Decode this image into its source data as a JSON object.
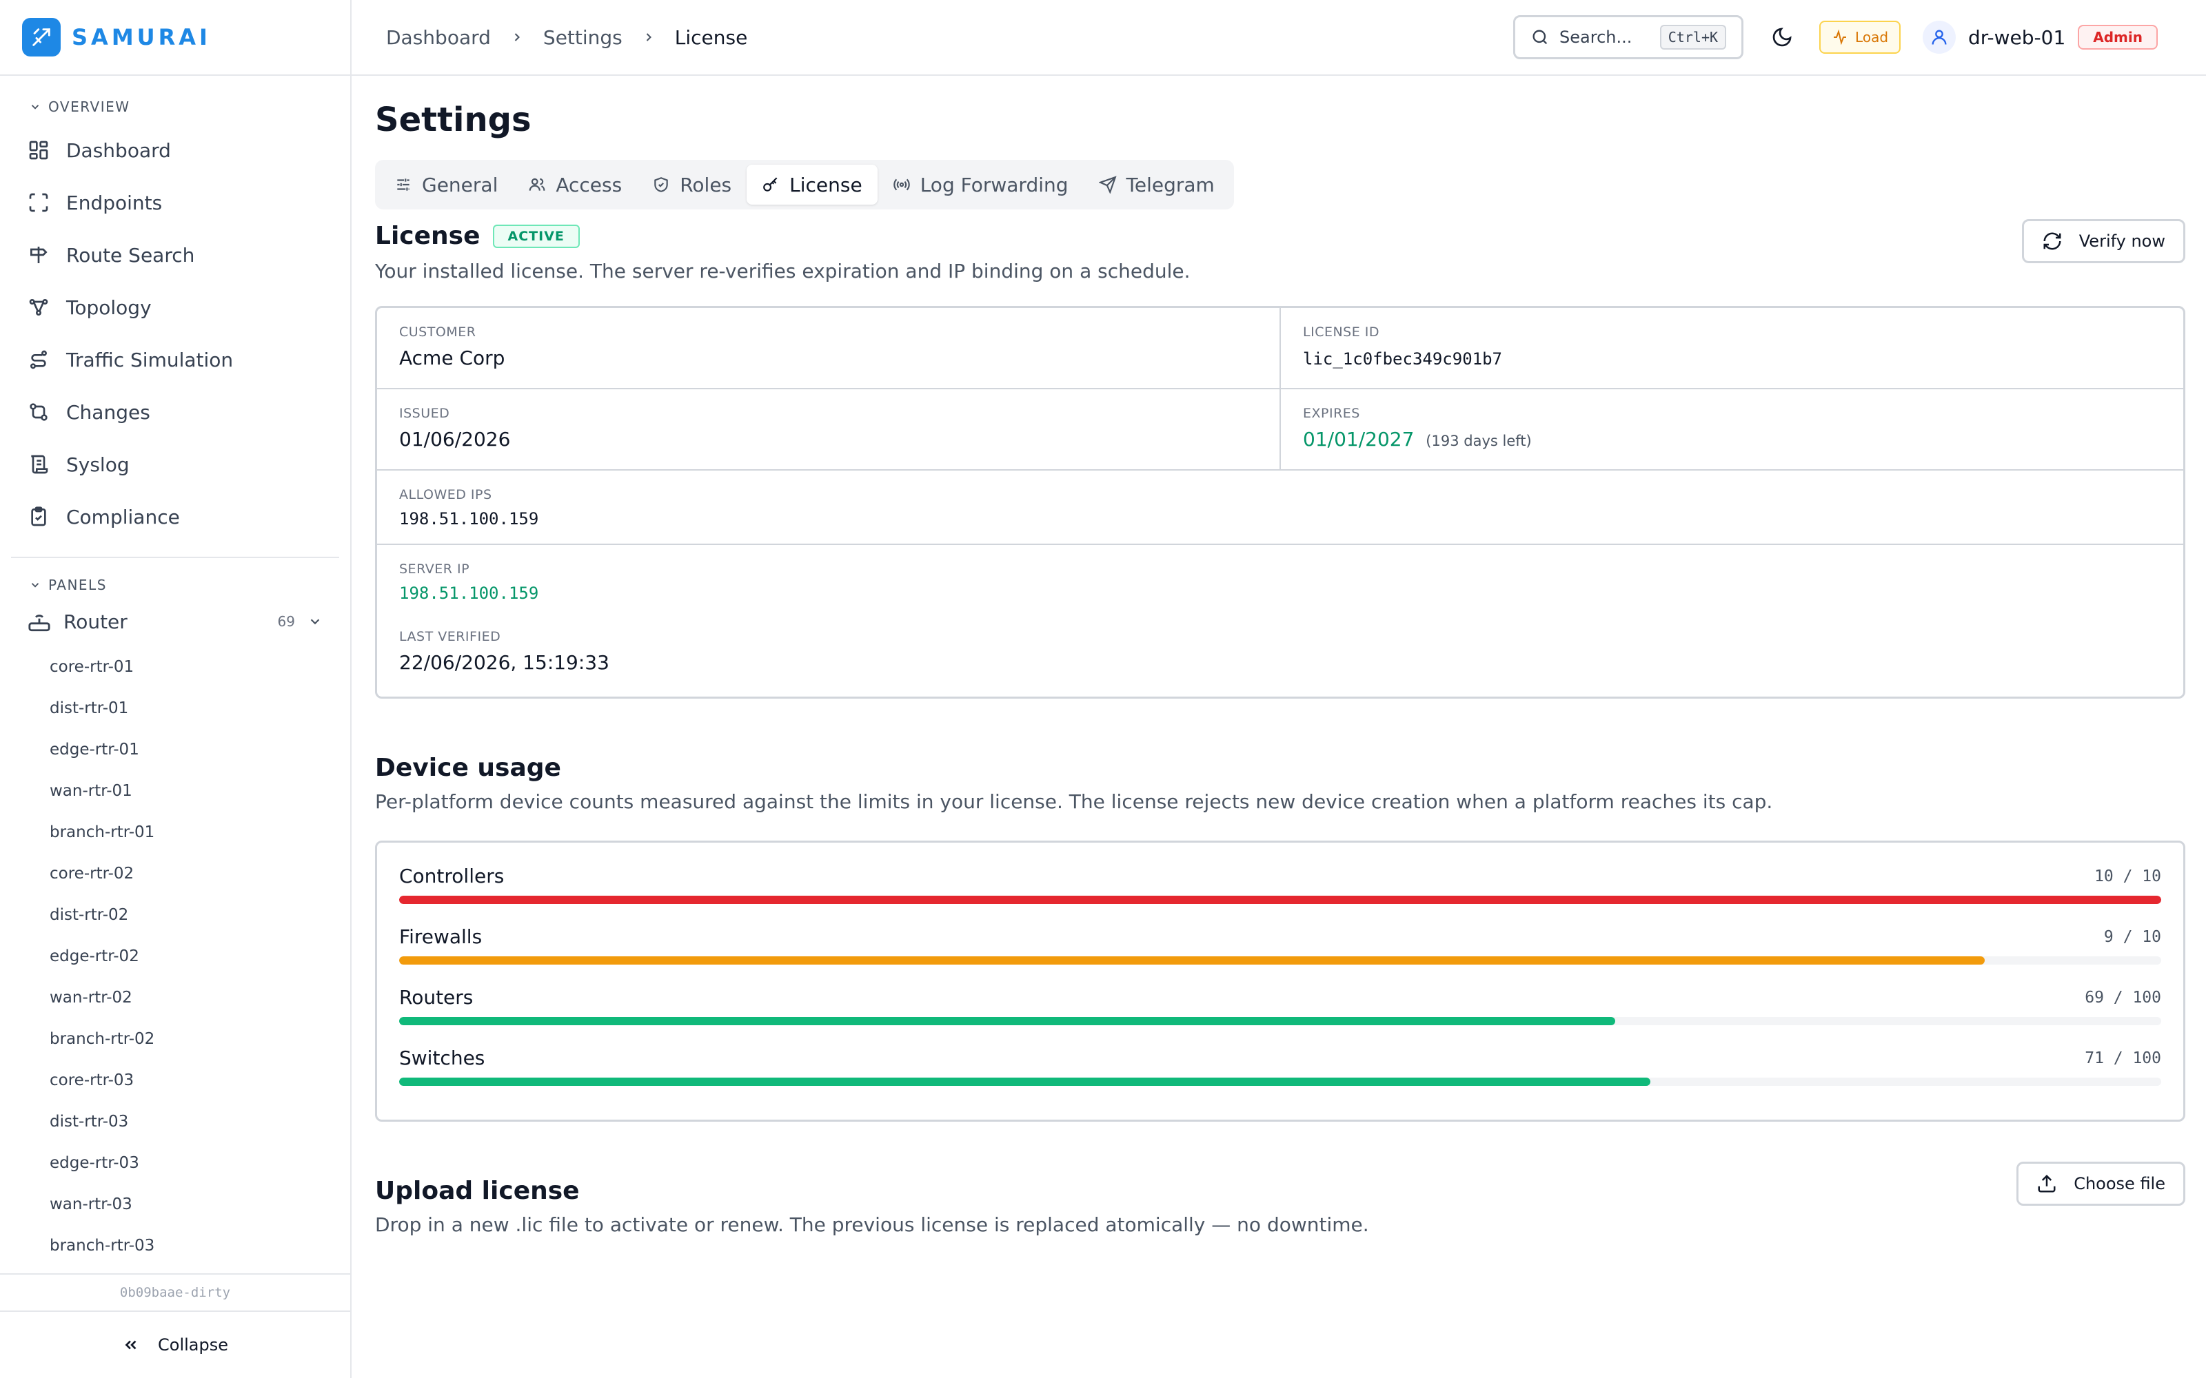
{
  "brand": {
    "name": "SAMURAI",
    "color": "#1e88e5"
  },
  "sidebar": {
    "overview_title": "OVERVIEW",
    "items": [
      {
        "label": "Dashboard",
        "icon": "grid-icon"
      },
      {
        "label": "Endpoints",
        "icon": "scan-frame-icon"
      },
      {
        "label": "Route Search",
        "icon": "signpost-icon"
      },
      {
        "label": "Topology",
        "icon": "topology-icon"
      },
      {
        "label": "Traffic Simulation",
        "icon": "route-icon"
      },
      {
        "label": "Changes",
        "icon": "git-compare-icon"
      },
      {
        "label": "Syslog",
        "icon": "scroll-icon"
      },
      {
        "label": "Compliance",
        "icon": "clipboard-check-icon"
      }
    ],
    "panels_title": "PANELS",
    "router_panel": {
      "label": "Router",
      "count": "69"
    },
    "routers": [
      "core-rtr-01",
      "dist-rtr-01",
      "edge-rtr-01",
      "wan-rtr-01",
      "branch-rtr-01",
      "core-rtr-02",
      "dist-rtr-02",
      "edge-rtr-02",
      "wan-rtr-02",
      "branch-rtr-02",
      "core-rtr-03",
      "dist-rtr-03",
      "edge-rtr-03",
      "wan-rtr-03",
      "branch-rtr-03"
    ],
    "build": "0b09baae-dirty",
    "collapse_label": "Collapse"
  },
  "header": {
    "breadcrumbs": [
      "Dashboard",
      "Settings",
      "License"
    ],
    "search_placeholder": "Search...",
    "search_shortcut": "Ctrl+K",
    "load_label": "Load",
    "user_name": "dr-web-01",
    "user_role": "Admin"
  },
  "page": {
    "title": "Settings",
    "tabs": [
      {
        "label": "General",
        "icon": "sliders-icon",
        "active": false
      },
      {
        "label": "Access",
        "icon": "users-icon",
        "active": false
      },
      {
        "label": "Roles",
        "icon": "shield-icon",
        "active": false
      },
      {
        "label": "License",
        "icon": "key-icon",
        "active": true
      },
      {
        "label": "Log Forwarding",
        "icon": "radio-icon",
        "active": false
      },
      {
        "label": "Telegram",
        "icon": "send-icon",
        "active": false
      }
    ]
  },
  "license": {
    "heading": "License",
    "status": "ACTIVE",
    "description": "Your installed license. The server re-verifies expiration and IP binding on a schedule.",
    "verify_label": "Verify now",
    "customer_label": "CUSTOMER",
    "customer": "Acme Corp",
    "id_label": "LICENSE ID",
    "id": "lic_1c0fbec349c901b7",
    "issued_label": "ISSUED",
    "issued": "01/06/2026",
    "expires_label": "EXPIRES",
    "expires": "01/01/2027",
    "days_left": "(193 days left)",
    "allowed_ips_label": "ALLOWED IPS",
    "allowed_ips": "198.51.100.159",
    "server_ip_label": "SERVER IP",
    "server_ip": "198.51.100.159",
    "last_verified_label": "LAST VERIFIED",
    "last_verified": "22/06/2026, 15:19:33"
  },
  "usage": {
    "heading": "Device usage",
    "description": "Per-platform device counts measured against the limits in your license. The license rejects new device creation when a platform reaches its cap.",
    "items": [
      {
        "name": "Controllers",
        "count": "10 / 10",
        "used": 10,
        "limit": 10,
        "color": "#e5272f"
      },
      {
        "name": "Firewalls",
        "count": "9 / 10",
        "used": 9,
        "limit": 10,
        "color": "#f29b0c"
      },
      {
        "name": "Routers",
        "count": "69 / 100",
        "used": 69,
        "limit": 100,
        "color": "#10b97a"
      },
      {
        "name": "Switches",
        "count": "71 / 100",
        "used": 71,
        "limit": 100,
        "color": "#10b97a"
      }
    ]
  },
  "upload": {
    "heading": "Upload license",
    "description": "Drop in a new .lic file to activate or renew. The previous license is replaced atomically — no downtime.",
    "button_label": "Choose file"
  }
}
